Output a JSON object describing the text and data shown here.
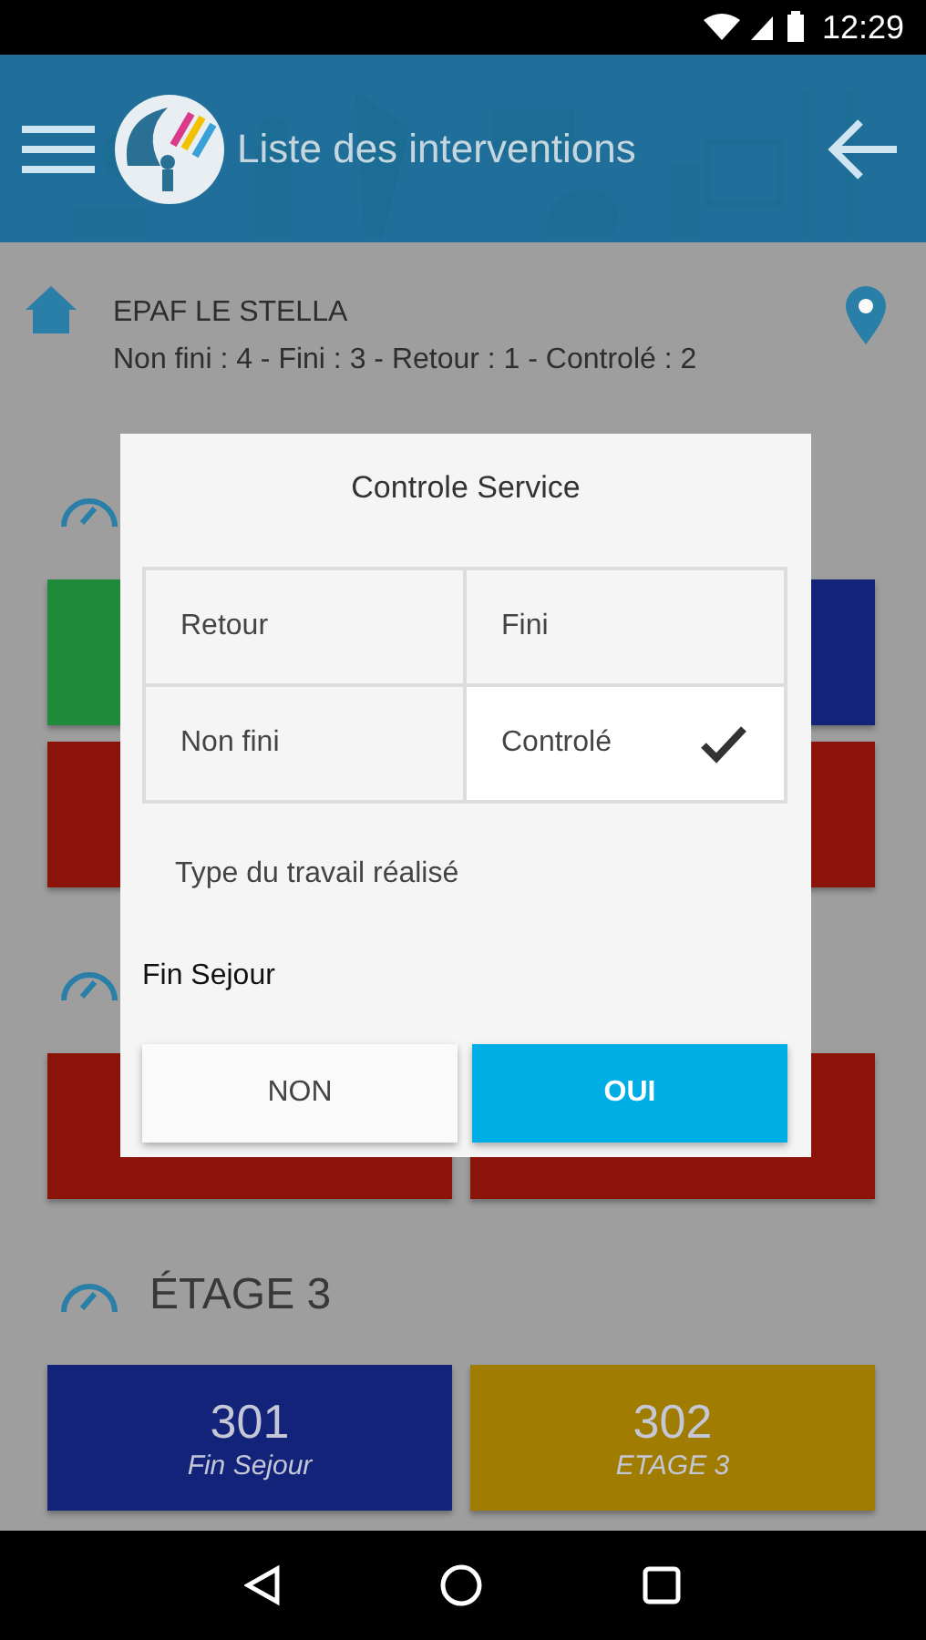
{
  "status_bar": {
    "time": "12:29"
  },
  "app_bar": {
    "title": "Liste des interventions"
  },
  "site": {
    "name": "EPAF LE STELLA",
    "summary": "Non fini : 4 - Fini : 3 - Retour : 1 - Controlé : 2"
  },
  "floors": [
    {
      "rooms": [
        {
          "color": "#1e8a3a"
        },
        {
          "color": "#13237a"
        },
        {
          "color": "#8b1309"
        },
        {
          "color": "#8b1309"
        }
      ]
    },
    {
      "rooms": [
        {
          "color": "#8b1309"
        },
        {
          "color": "#8b1309"
        }
      ]
    },
    {
      "title": "ÉTAGE 3",
      "rooms": [
        {
          "number": "301",
          "label": "Fin Sejour",
          "color": "#13237a"
        },
        {
          "number": "302",
          "label": "ETAGE 3",
          "color": "#a07c00"
        }
      ]
    }
  ],
  "dialog": {
    "title": "Controle Service",
    "choices": [
      {
        "label": "Retour",
        "selected": false
      },
      {
        "label": "Fini",
        "selected": false
      },
      {
        "label": "Non fini",
        "selected": false
      },
      {
        "label": "Controlé",
        "selected": true
      }
    ],
    "work_type": "Type du travail réalisé",
    "question": "Fin Sejour",
    "buttons": [
      {
        "label": "NON",
        "kind": "secondary"
      },
      {
        "label": "OUI",
        "kind": "primary"
      }
    ]
  }
}
